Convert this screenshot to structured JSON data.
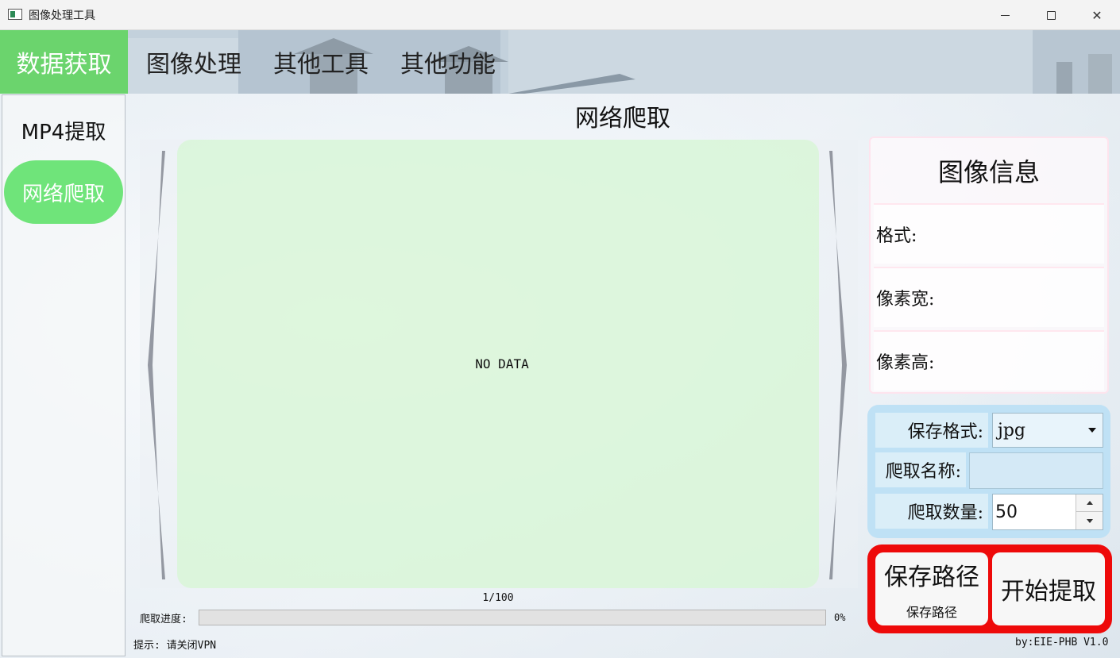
{
  "window": {
    "title": "图像处理工具",
    "minimize_label": "—",
    "maximize_label": "□",
    "close_label": "✕"
  },
  "nav": {
    "items": [
      "数据获取",
      "图像处理",
      "其他工具",
      "其他功能"
    ],
    "active_index": 0
  },
  "sidebar": {
    "items": [
      "MP4提取",
      "网络爬取"
    ],
    "active_index": 1
  },
  "page": {
    "title": "网络爬取"
  },
  "viewer": {
    "placeholder": "NO DATA",
    "counter": "1/100"
  },
  "progress": {
    "label": "爬取进度:",
    "value": 0,
    "percent_text": "0%"
  },
  "footer": {
    "tip": "提示: 请关闭VPN",
    "credit": "by:EIE-PHB V1.0"
  },
  "info": {
    "title": "图像信息",
    "format_label": "格式:",
    "width_label": "像素宽:",
    "height_label": "像素高:"
  },
  "settings": {
    "save_format_label": "保存格式:",
    "save_format_value": "jpg",
    "crawl_name_label": "爬取名称:",
    "crawl_name_value": "",
    "crawl_count_label": "爬取数量:",
    "crawl_count_value": "50"
  },
  "actions": {
    "save_path_label": "保存路径",
    "save_path_sub": "保存路径",
    "start_label": "开始提取"
  },
  "colors": {
    "accent_green": "#6bd46d",
    "sidebar_active": "#6fe47a",
    "viewer_bg": "#d6f6d2",
    "settings_bg": "#bfe1f5",
    "highlight_red": "#ee0a0a"
  }
}
